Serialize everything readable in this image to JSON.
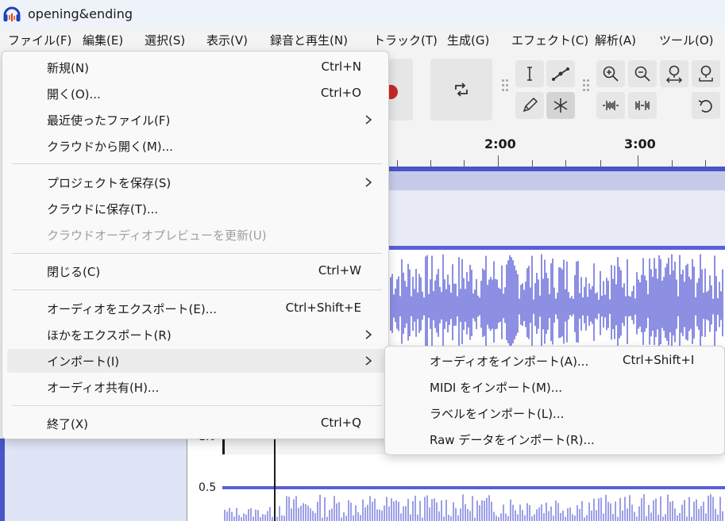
{
  "window": {
    "title": "opening&ending"
  },
  "menubar": {
    "items": [
      {
        "label": "ファイル(F)"
      },
      {
        "label": "編集(E)"
      },
      {
        "label": "選択(S)"
      },
      {
        "label": "表示(V)"
      },
      {
        "label": "録音と再生(N)"
      },
      {
        "label": "トラック(T)"
      },
      {
        "label": "生成(G)"
      },
      {
        "label": "エフェクト(C)"
      },
      {
        "label": "解析(A)"
      },
      {
        "label": "ツール(O)"
      }
    ]
  },
  "file_menu": {
    "items": [
      {
        "label": "新規(N)",
        "shortcut": "Ctrl+N"
      },
      {
        "label": "開く(O)...",
        "shortcut": "Ctrl+O"
      },
      {
        "label": "最近使ったファイル(F)",
        "shortcut": ""
      },
      {
        "label": "クラウドから開く(M)...",
        "shortcut": ""
      },
      {
        "label": "プロジェクトを保存(S)",
        "shortcut": ""
      },
      {
        "label": "クラウドに保存(T)...",
        "shortcut": ""
      },
      {
        "label": "クラウドオーディオプレビューを更新(U)",
        "shortcut": ""
      },
      {
        "label": "閉じる(C)",
        "shortcut": "Ctrl+W"
      },
      {
        "label": "オーディオをエクスポート(E)...",
        "shortcut": "Ctrl+Shift+E"
      },
      {
        "label": "ほかをエクスポート(R)",
        "shortcut": ""
      },
      {
        "label": "インポート(I)",
        "shortcut": ""
      },
      {
        "label": "オーディオ共有(H)...",
        "shortcut": ""
      },
      {
        "label": "終了(X)",
        "shortcut": "Ctrl+Q"
      }
    ]
  },
  "import_submenu": {
    "items": [
      {
        "label": "オーディオをインポート(A)...",
        "shortcut": "Ctrl+Shift+I"
      },
      {
        "label": "MIDI をインポート(M)...",
        "shortcut": ""
      },
      {
        "label": "ラベルをインポート(L)...",
        "shortcut": ""
      },
      {
        "label": "Raw データをインポート(R)...",
        "shortcut": ""
      }
    ]
  },
  "timeline": {
    "labels": [
      "2:00",
      "3:00"
    ]
  },
  "track": {
    "scale_labels": [
      "1.0",
      "0.5"
    ]
  },
  "colors": {
    "wave": "#5b5fd6",
    "track_bar": "#4a55c8",
    "record_red": "#c62828"
  },
  "icons": [
    "audacity-app-icon",
    "record-icon",
    "loop-icon",
    "select-tool-icon",
    "envelope-tool-icon",
    "draw-tool-icon",
    "multi-tool-icon",
    "zoom-in-icon",
    "zoom-out-icon",
    "fit-selection-icon",
    "fit-project-icon",
    "trim-icon",
    "silence-icon",
    "undo-icon",
    "submenu-arrow-icon"
  ]
}
